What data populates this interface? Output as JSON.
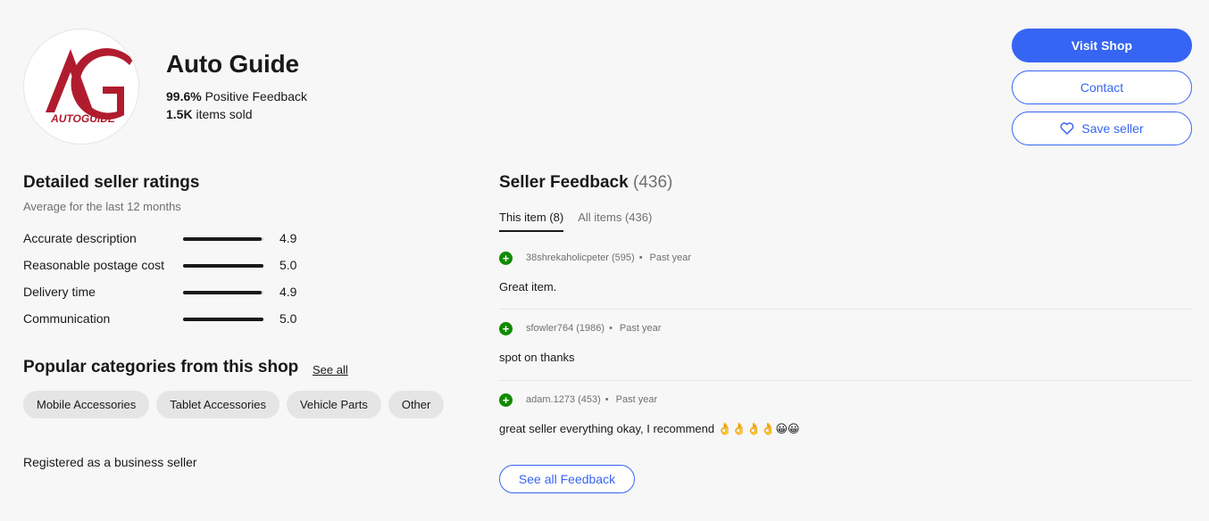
{
  "seller": {
    "name": "Auto Guide",
    "logo_text": "AUTOGUIDE",
    "feedback_pct": "99.6%",
    "feedback_label": "Positive Feedback",
    "items_sold": "1.5K",
    "items_sold_label": "items sold"
  },
  "actions": {
    "visit_shop": "Visit Shop",
    "contact": "Contact",
    "save_seller": "Save seller"
  },
  "ratings": {
    "title": "Detailed seller ratings",
    "subtitle": "Average for the last 12 months",
    "scale_max": 5,
    "items": [
      {
        "label": "Accurate description",
        "value": "4.9"
      },
      {
        "label": "Reasonable postage cost",
        "value": "5.0"
      },
      {
        "label": "Delivery time",
        "value": "4.9"
      },
      {
        "label": "Communication",
        "value": "5.0"
      }
    ]
  },
  "categories": {
    "title": "Popular categories from this shop",
    "see_all": "See all",
    "items": [
      "Mobile Accessories",
      "Tablet Accessories",
      "Vehicle Parts",
      "Other"
    ]
  },
  "business_note": "Registered as a business seller",
  "feedback": {
    "title": "Seller Feedback",
    "count": "(436)",
    "tabs": [
      {
        "label": "This item (8)",
        "active": true
      },
      {
        "label": "All items (436)",
        "active": false
      }
    ],
    "entries": [
      {
        "user": "38shrekaholicpeter (595)",
        "time": "Past year",
        "text": "Great item."
      },
      {
        "user": "sfowler764 (1986)",
        "time": "Past year",
        "text": "spot on thanks"
      },
      {
        "user": "adam.1273 (453)",
        "time": "Past year",
        "text": "great seller everything okay, I recommend 👌👌👌👌😀😀"
      }
    ],
    "see_all": "See all Feedback"
  },
  "colors": {
    "primary": "#3665f3",
    "positive": "#118a00",
    "logo_red": "#b01c2e"
  }
}
